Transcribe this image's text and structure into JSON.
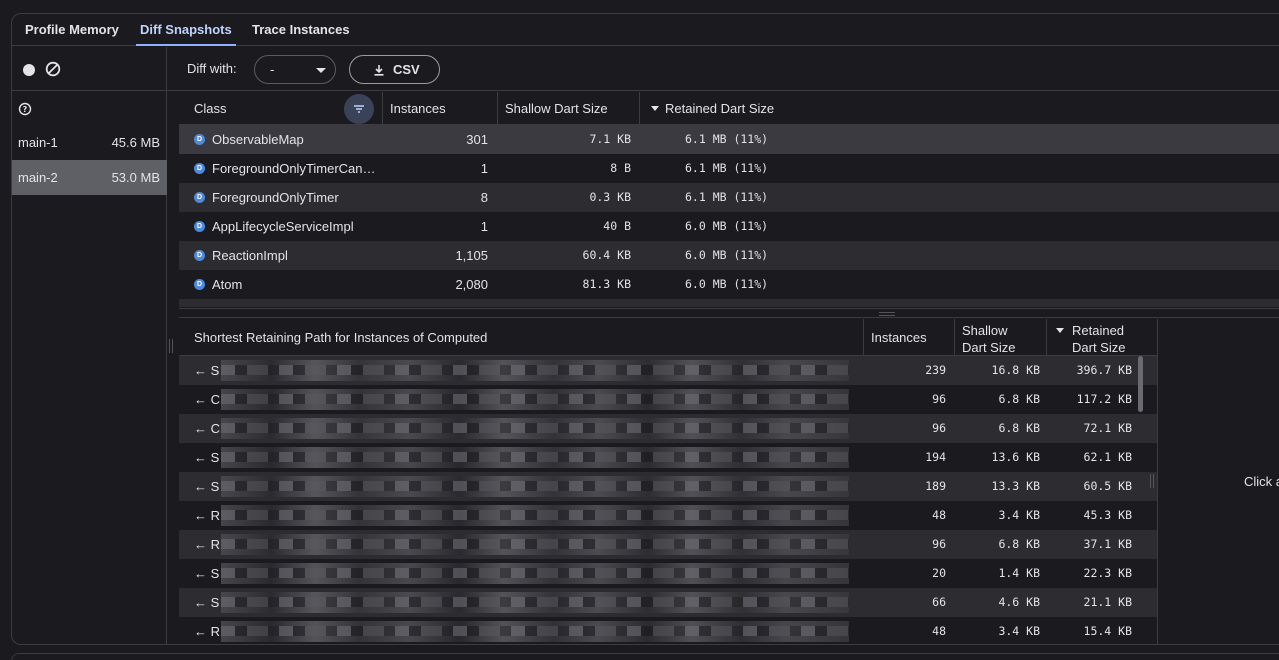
{
  "tabs": [
    {
      "label": "Profile Memory"
    },
    {
      "label": "Diff Snapshots"
    },
    {
      "label": "Trace Instances"
    }
  ],
  "snapshots": [
    {
      "name": "main-1",
      "size": "45.6 MB"
    },
    {
      "name": "main-2",
      "size": "53.0 MB",
      "selected": true
    }
  ],
  "diff_toolbar": {
    "diff_with_label": "Diff with:",
    "diff_with_value": "-",
    "csv_label": "CSV"
  },
  "class_table": {
    "headers": {
      "class": "Class",
      "instances": "Instances",
      "shallow": "Shallow Dart Size",
      "retained": "Retained Dart Size"
    },
    "rows": [
      {
        "badge": "D",
        "class": "ObservableMap",
        "instances": "301",
        "shallow": "7.1 KB",
        "retained": "6.1 MB (11%)"
      },
      {
        "badge": "D",
        "class": "ForegroundOnlyTimerCan…",
        "instances": "1",
        "shallow": "8 B",
        "retained": "6.1 MB (11%)"
      },
      {
        "badge": "D",
        "class": "ForegroundOnlyTimer",
        "instances": "8",
        "shallow": "0.3 KB",
        "retained": "6.1 MB (11%)"
      },
      {
        "badge": "D",
        "class": "AppLifecycleServiceImpl",
        "instances": "1",
        "shallow": "40 B",
        "retained": "6.0 MB (11%)"
      },
      {
        "badge": "D",
        "class": "ReactionImpl",
        "instances": "1,105",
        "shallow": "60.4 KB",
        "retained": "6.0 MB (11%)"
      },
      {
        "badge": "D",
        "class": "Atom",
        "instances": "2,080",
        "shallow": "81.3 KB",
        "retained": "6.0 MB (11%)"
      }
    ]
  },
  "path_table": {
    "headers": {
      "path": "Shortest Retaining Path for Instances of Computed",
      "instances": "Instances",
      "shallow_line1": "Shallow",
      "shallow_line2": "Dart Size",
      "retained_line1": "Retained",
      "retained_line2": "Dart Size"
    },
    "rows": [
      {
        "prefix": "← S",
        "instances": "239",
        "shallow": "16.8 KB",
        "retained": "396.7 KB"
      },
      {
        "prefix": "← C",
        "instances": "96",
        "shallow": "6.8 KB",
        "retained": "117.2 KB"
      },
      {
        "prefix": "← C",
        "instances": "96",
        "shallow": "6.8 KB",
        "retained": "72.1 KB"
      },
      {
        "prefix": "← S",
        "instances": "194",
        "shallow": "13.6 KB",
        "retained": "62.1 KB"
      },
      {
        "prefix": "← S",
        "instances": "189",
        "shallow": "13.3 KB",
        "retained": "60.5 KB"
      },
      {
        "prefix": "← R",
        "instances": "48",
        "shallow": "3.4 KB",
        "retained": "45.3 KB"
      },
      {
        "prefix": "← R",
        "instances": "96",
        "shallow": "6.8 KB",
        "retained": "37.1 KB"
      },
      {
        "prefix": "← S",
        "instances": "20",
        "shallow": "1.4 KB",
        "retained": "22.3 KB"
      },
      {
        "prefix": "← S",
        "instances": "66",
        "shallow": "4.6 KB",
        "retained": "21.1 KB"
      },
      {
        "prefix": "← R",
        "instances": "48",
        "shallow": "3.4 KB",
        "retained": "15.4 KB"
      }
    ]
  },
  "right_panel": {
    "message": "Click a"
  },
  "colors": {
    "accent": "#8fb0ff",
    "badge": "#4e8ad8",
    "selected_row": "#5f5f66"
  }
}
